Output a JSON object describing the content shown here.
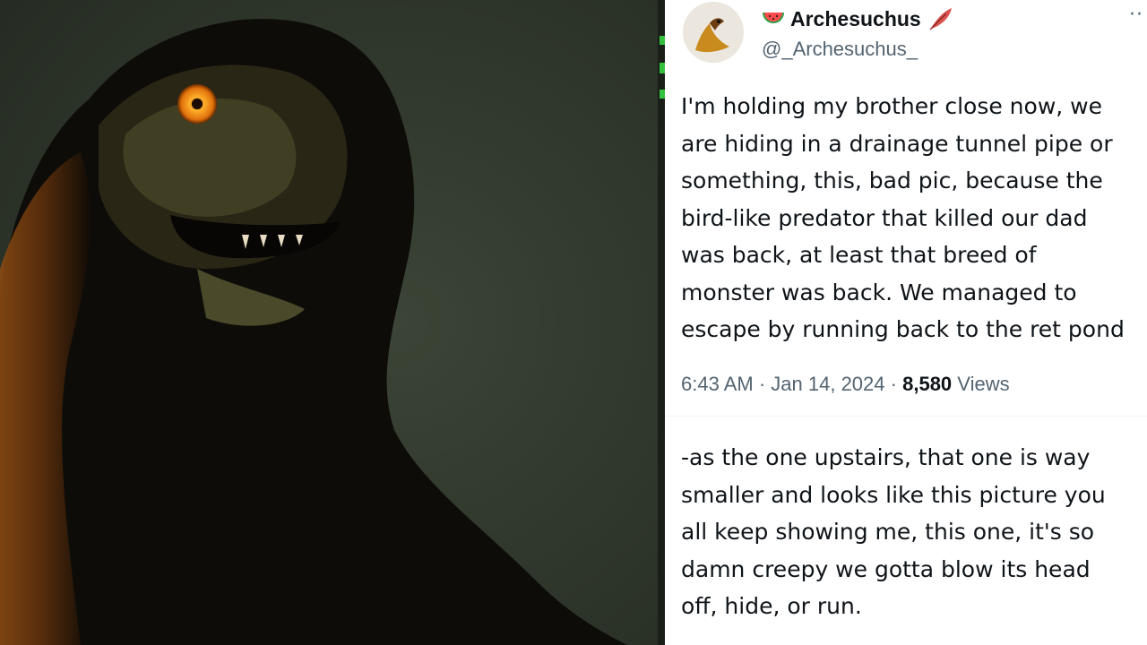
{
  "photo": {
    "subject": "dark monster figure with glowing orange eye"
  },
  "tweet": {
    "display_name": "Archesuchus",
    "handle": "@_Archesuchus_",
    "more_label": "··",
    "name_prefix_icon": "watermelon-icon",
    "name_suffix_icon": "feather-icon",
    "text": "I'm holding my brother close now, we\nare hiding in a drainage tunnel pipe or\nsomething, this, bad pic, because the\nbird-like predator that killed our dad\nwas back, at least that breed of\nmonster was back. We managed to\nescape by running back to the ret pond",
    "time": "6:43 AM",
    "date": "Jan 14, 2024",
    "views_count": "8,580",
    "views_label": "Views",
    "reply_text": "-as the one upstairs, that one is way\nsmaller and looks like this picture you\nall keep showing me, this one, it's so\ndamn creepy we gotta blow its head\noff, hide, or run.",
    "accent_color": "#536471"
  }
}
